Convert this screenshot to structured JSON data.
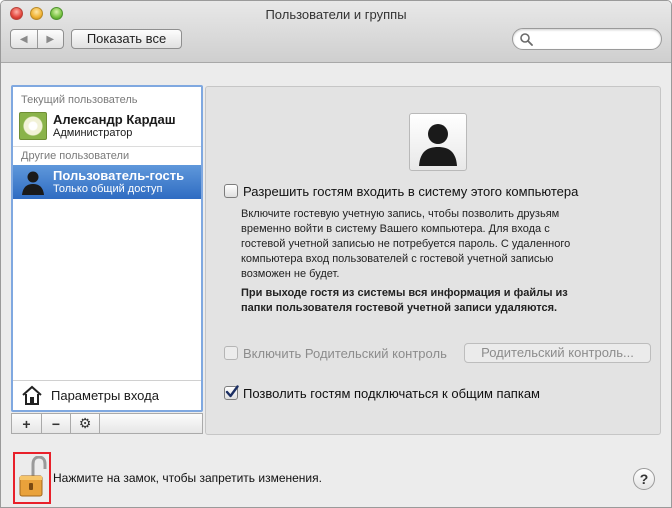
{
  "window": {
    "title": "Пользователи и группы"
  },
  "toolbar": {
    "back_glyph": "◀",
    "forward_glyph": "▶",
    "show_all_label": "Показать все",
    "search_placeholder": ""
  },
  "sidebar": {
    "current_header": "Текущий пользователь",
    "current_user": {
      "name": "Александр Кардаш",
      "role": "Администратор"
    },
    "other_header": "Другие пользователи",
    "guest_user": {
      "name": "Пользователь-гость",
      "role": "Только общий доступ"
    },
    "login_options_label": "Параметры входа",
    "add_label": "+",
    "remove_label": "−",
    "gear_label": "⚙"
  },
  "content": {
    "allow_guests": {
      "label": "Разрешить гостям входить в систему этого компьютера",
      "checked": false,
      "desc_lines": [
        "Включите гостевую учетную запись, чтобы позволить друзьям",
        "временно войти в систему Вашего компьютера. Для входа с",
        "гостевой учетной записью не потребуется пароль. С удаленного",
        "компьютера вход пользователей с гостевой учетной записью",
        "возможен не будет."
      ],
      "bold_lines": [
        "При выходе гостя из системы вся информация и файлы из",
        "папки пользователя гостевой учетной записи удаляются."
      ]
    },
    "parental": {
      "label": "Включить Родительский контроль",
      "button_label": "Родительский контроль...",
      "enabled": false
    },
    "shared_folders": {
      "label": "Позволить гостям подключаться к общим папкам",
      "checked": true
    }
  },
  "footer": {
    "lock_text": "Нажмите на замок, чтобы запретить изменения.",
    "help_label": "?"
  },
  "colors": {
    "selection": "#2f6cc2",
    "lock_highlight": "#e8202a",
    "checkbox_check": "#1c2f63"
  }
}
